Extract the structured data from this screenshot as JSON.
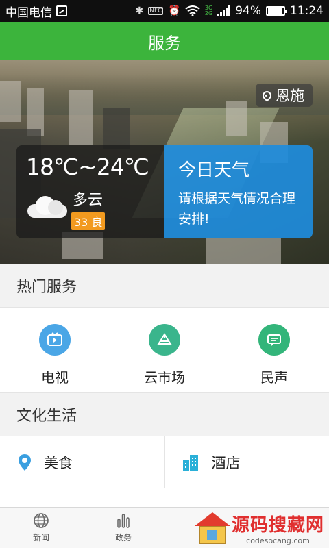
{
  "status_bar": {
    "carrier": "中国电信",
    "battery": "94%",
    "battery_level": 0.94,
    "time": "11:24",
    "nfc": "NFC",
    "net_3g": "3G",
    "net_2g": "2G"
  },
  "header": {
    "title": "服务"
  },
  "banner": {
    "location": "恩施",
    "weather": {
      "temperature": "18℃~24℃",
      "condition": "多云",
      "aqi": "33 良"
    },
    "tip": {
      "title": "今日天气",
      "text": "请根据天气情况合理安排!"
    }
  },
  "hot_services": {
    "title": "热门服务",
    "items": [
      {
        "label": "电视",
        "icon": "tv-icon",
        "color": "#4aa6e6"
      },
      {
        "label": "云市场",
        "icon": "market-icon",
        "color": "#3ab58c"
      },
      {
        "label": "民声",
        "icon": "chat-icon",
        "color": "#33b57a"
      }
    ]
  },
  "culture": {
    "title": "文化生活",
    "items": [
      {
        "label": "美食",
        "icon": "location-pin-icon",
        "color": "#3a9fe0"
      },
      {
        "label": "酒店",
        "icon": "building-icon",
        "color": "#2ab0d8"
      }
    ]
  },
  "bottom_nav": {
    "items": [
      {
        "label": "新闻",
        "icon": "globe-icon"
      },
      {
        "label": "政务",
        "icon": "bar-chart-icon"
      }
    ]
  },
  "watermark": {
    "name": "源码搜藏网",
    "url": "codesocang.com"
  }
}
